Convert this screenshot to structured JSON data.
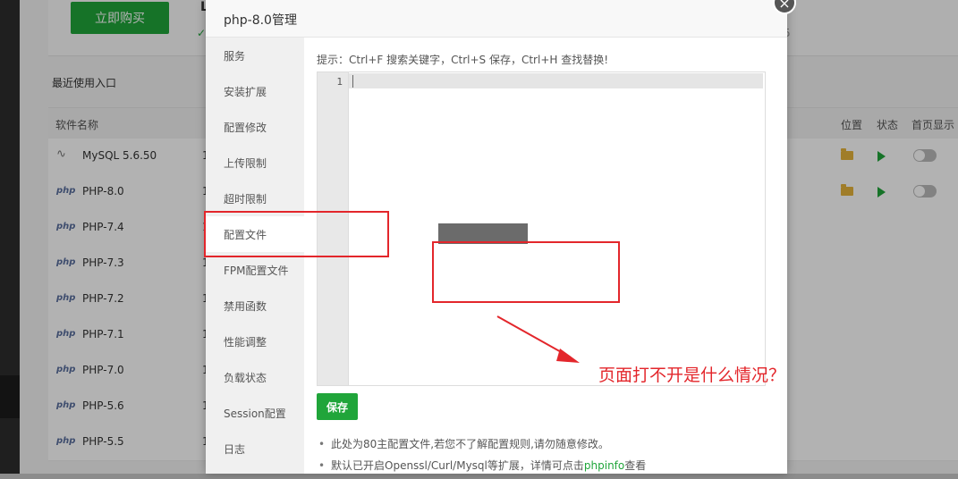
{
  "background": {
    "buy_button": "立即购买",
    "partial_title": "L",
    "partial_check": "✓",
    "partial_number": "5",
    "recent_label": "最近使用入口",
    "table": {
      "headers": [
        "软件名称",
        "位置",
        "状态",
        "首页显示"
      ],
      "rows": [
        {
          "name": "MySQL 5.6.50",
          "icon": "mysql-icon",
          "col": "1",
          "actions": true
        },
        {
          "name": "PHP-8.0",
          "icon": "php-icon",
          "col": "1",
          "actions": true
        },
        {
          "name": "PHP-7.4",
          "icon": "php-icon",
          "col": "1",
          "actions": false
        },
        {
          "name": "PHP-7.3",
          "icon": "php-icon",
          "col": "1",
          "actions": false
        },
        {
          "name": "PHP-7.2",
          "icon": "php-icon",
          "col": "1",
          "actions": false
        },
        {
          "name": "PHP-7.1",
          "icon": "php-icon",
          "col": "1",
          "actions": false
        },
        {
          "name": "PHP-7.0",
          "icon": "php-icon",
          "col": "1",
          "actions": false
        },
        {
          "name": "PHP-5.6",
          "icon": "php-icon",
          "col": "1",
          "actions": false
        },
        {
          "name": "PHP-5.5",
          "icon": "php-icon",
          "col": "1",
          "actions": false
        }
      ],
      "php_icon_text": "php"
    }
  },
  "modal": {
    "title": "php-8.0管理",
    "close_icon": "×",
    "sidebar": [
      {
        "label": "服务",
        "active": false
      },
      {
        "label": "安装扩展",
        "active": false
      },
      {
        "label": "配置修改",
        "active": false
      },
      {
        "label": "上传限制",
        "active": false
      },
      {
        "label": "超时限制",
        "active": false
      },
      {
        "label": "配置文件",
        "active": true
      },
      {
        "label": "FPM配置文件",
        "active": false
      },
      {
        "label": "禁用函数",
        "active": false
      },
      {
        "label": "性能调整",
        "active": false
      },
      {
        "label": "负载状态",
        "active": false
      },
      {
        "label": "Session配置",
        "active": false
      },
      {
        "label": "日志",
        "active": false
      }
    ],
    "tip": "提示：Ctrl+F 搜索关键字，Ctrl+S 保存，Ctrl+H 查找替换!",
    "editor": {
      "line_number": "1"
    },
    "save_label": "保存",
    "notes": [
      {
        "text": "此处为80主配置文件,若您不了解配置规则,请勿随意修改。"
      },
      {
        "text": "默认已开启Openssl/Curl/Mysql等扩展，详情可点击",
        "link": "phpinfo",
        "suffix": "查看"
      }
    ]
  },
  "annotation": {
    "question": "页面打不开是什么情况？",
    "color": "#e3262b"
  },
  "colors": {
    "accent": "#20a53a"
  }
}
